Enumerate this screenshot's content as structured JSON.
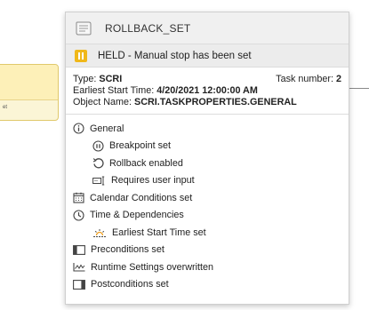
{
  "background": {
    "node_label": "et"
  },
  "card": {
    "title": "ROLLBACK_SET",
    "status": {
      "icon": "pause-icon",
      "color": "#f0b81a",
      "text": "HELD - Manual stop has been set"
    },
    "info": {
      "type_label": "Type:",
      "type_value": "SCRI",
      "task_label": "Task number:",
      "task_value": "2",
      "start_label": "Earliest Start Time:",
      "start_value": "4/20/2021 12:00:00 AM",
      "object_label": "Object Name:",
      "object_value": "SCRI.TASKPROPERTIES.GENERAL"
    },
    "details": [
      {
        "icon": "info-icon",
        "label": "General"
      },
      {
        "icon": "breakpoint-icon",
        "label": "Breakpoint set"
      },
      {
        "icon": "rollback-icon",
        "label": "Rollback enabled"
      },
      {
        "icon": "user-input-icon",
        "label": "Requires user input"
      },
      {
        "icon": "calendar-icon",
        "label": "Calendar Conditions set"
      },
      {
        "icon": "clock-icon",
        "label": "Time & Dependencies"
      },
      {
        "icon": "sunrise-icon",
        "label": "Earliest Start Time set"
      },
      {
        "icon": "preconditions-icon",
        "label": "Preconditions set"
      },
      {
        "icon": "runtime-chart-icon",
        "label": "Runtime Settings overwritten"
      },
      {
        "icon": "postconditions-icon",
        "label": "Postconditions set"
      }
    ]
  }
}
